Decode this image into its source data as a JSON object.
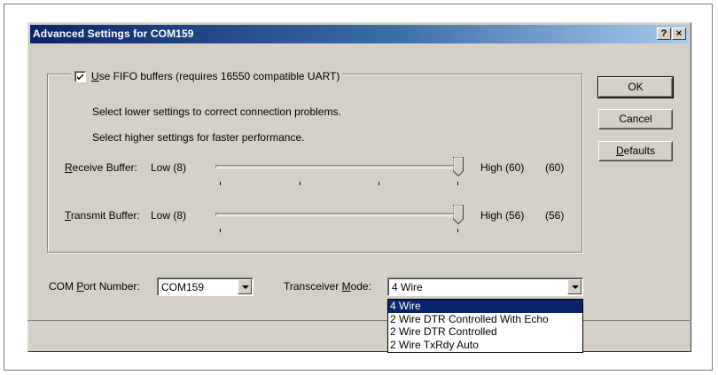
{
  "window": {
    "title": "Advanced Settings for COM159",
    "help_button": "?",
    "close_button": "×"
  },
  "fifo": {
    "checked": true,
    "label_prefix": "",
    "label_underline": "U",
    "label_rest": "se FIFO buffers (requires 16550 compatible UART)"
  },
  "info": {
    "line1": "Select lower settings to correct connection problems.",
    "line2": "Select higher settings for faster performance."
  },
  "receive": {
    "label_underline": "R",
    "label_rest": "eceive Buffer:",
    "low": "Low (8)",
    "high": "High (60)",
    "value": "(60)",
    "level": 1.0
  },
  "transmit": {
    "label_underline": "T",
    "label_rest": "ransmit Buffer:",
    "low": "Low (8)",
    "high": "High (56)",
    "value": "(56)",
    "level": 1.0
  },
  "buttons": {
    "ok": "OK",
    "cancel": "Cancel",
    "defaults_underline": "D",
    "defaults_rest": "efaults"
  },
  "com_port": {
    "label_prefix": "COM ",
    "label_underline": "P",
    "label_rest": "ort Number:",
    "value": "COM159"
  },
  "transceiver": {
    "label_prefix": "Transceiver ",
    "label_underline": "M",
    "label_rest": "ode:",
    "value": "4 Wire",
    "options": [
      "4 Wire",
      "2 Wire DTR Controlled With Echo",
      "2 Wire DTR Controlled",
      "2 Wire TxRdy Auto"
    ],
    "selected_index": 0
  }
}
